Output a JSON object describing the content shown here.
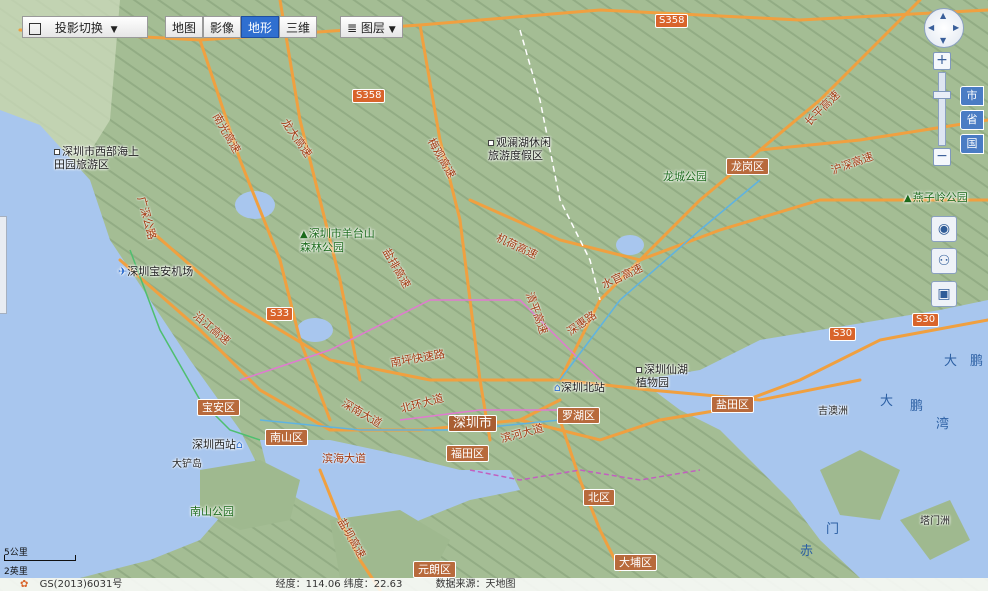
{
  "toolbar": {
    "projection_label": "投影切换",
    "map_types": [
      "地图",
      "影像",
      "地形",
      "三维"
    ],
    "active_map_type": "地形",
    "layers_label": "图层"
  },
  "zoom_levels": {
    "city": "市",
    "province": "省",
    "country": "国"
  },
  "districts": {
    "longgang": "龙岗区",
    "baoan": "宝安区",
    "nanshan": "南山区",
    "futian": "福田区",
    "luohu": "罗湖区",
    "yantian": "盐田区",
    "yuanlang": "元朗区",
    "north": "北区",
    "taipo": "大埔区",
    "shenzhen": "深圳市"
  },
  "places": {
    "west_park": "深圳市西部海上田园旅游区",
    "guanlan": "观澜湖休闲旅游度假区",
    "yangtai": "深圳市羊台山森林公园",
    "airport": "深圳宝安机场",
    "north_station": "深圳北站",
    "west_station": "深圳西站",
    "xianhu": "深圳仙湖植物园",
    "longcheng": "龙城公园",
    "yanziling": "燕子岭公园",
    "nanshan_park": "南山公园",
    "daming": "大铲岛",
    "jiqing": "吉澳洲",
    "tamen": "塔门洲"
  },
  "water_labels": {
    "dapeng1": "大",
    "dapeng2": "鹏",
    "dapeng3": "湾",
    "peng": "鹏",
    "da": "大",
    "chi": "赤",
    "men": "门"
  },
  "road_shields": {
    "s358": "S358",
    "s358b": "S358",
    "s33": "S33",
    "s30a": "S30",
    "s30b": "S30"
  },
  "road_names": {
    "nanguang": "南光高速",
    "longda": "龙大高速",
    "meiguan": "梅观高速",
    "shuiguan": "水官高速",
    "jihe": "机荷高速",
    "yanpai": "盐排高速",
    "hukou": "沪深高速",
    "guangshen": "广深公路",
    "yanba": "盐坝高速",
    "nanping": "南坪快速路",
    "beihuan": "北环大道",
    "binhai": "滨海大道",
    "binhe": "滨河大道",
    "qingping": "清平高速",
    "shenhui": "深惠路",
    "huayuan": "沿江高速",
    "changping": "长平高速",
    "shennan": "深南大道"
  },
  "scale": {
    "km": "5公里",
    "mile": "2英里"
  },
  "status": {
    "copyright": "GS(2013)6031号",
    "coords": "经度：114.06  纬度：22.63",
    "source": "数据来源：天地图"
  }
}
